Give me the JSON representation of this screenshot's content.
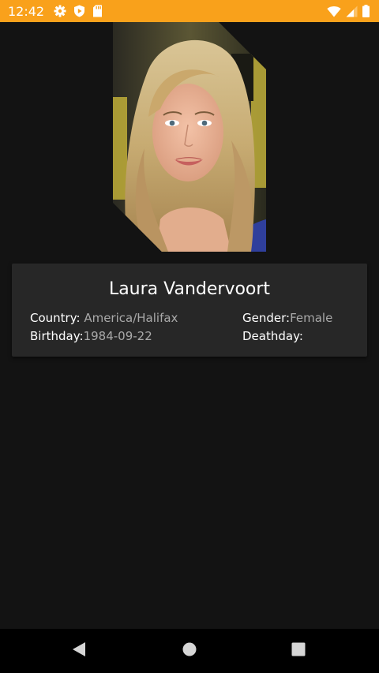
{
  "status_bar": {
    "time": "12:42",
    "left_icons": [
      "gear-icon",
      "shield-play-icon",
      "sd-card-icon"
    ],
    "right_icons": [
      "wifi-icon",
      "signal-icon",
      "battery-icon"
    ],
    "background_color": "#f9a11b"
  },
  "actor": {
    "name": "Laura Vandervoort",
    "photo_alt": "Laura Vandervoort"
  },
  "details": {
    "country_label": "Country: ",
    "country_value": "America/Halifax",
    "birthday_label": "Birthday:",
    "birthday_value": "1984-09-22",
    "gender_label": "Gender:",
    "gender_value": "Female",
    "deathday_label": "Deathday:",
    "deathday_value": ""
  },
  "nav_bar": {
    "buttons": [
      "back-icon",
      "home-icon",
      "recents-icon"
    ]
  },
  "colors": {
    "background": "#131313",
    "card": "#272727",
    "label_text": "#ffffff",
    "value_text": "#a9a9a9"
  }
}
